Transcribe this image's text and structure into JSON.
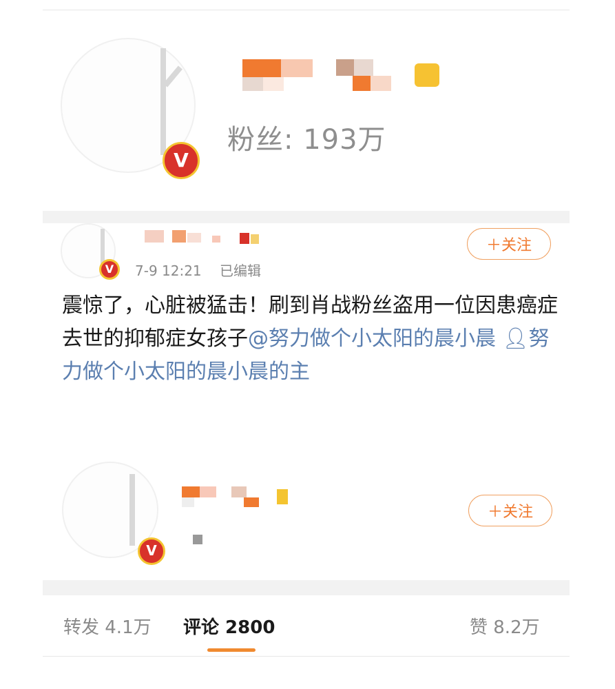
{
  "profile": {
    "fans_label": "粉丝",
    "fans_count": "193万",
    "badge_icon": "v-verified-badge"
  },
  "post": {
    "date": "7-9 12:21",
    "edited": "已编辑",
    "follow_label": "＋关注",
    "text_main": "震惊了，心脏被猛击！刷到肖战粉丝盗用一位因患癌症去世的抑郁症女孩子",
    "mention": "@努力做个小太阳的晨小晨",
    "person_link": "努力做个小太阳的晨小晨的主"
  },
  "repost_card": {
    "follow_label": "＋关注"
  },
  "tabs": {
    "repost": "转发 4.1万",
    "comments": "评论 2800",
    "likes": "赞 8.2万"
  },
  "colors": {
    "accent": "#f07a30",
    "link": "#5b7fb0",
    "badge_red": "#d8322a",
    "badge_gold": "#f4c430"
  }
}
